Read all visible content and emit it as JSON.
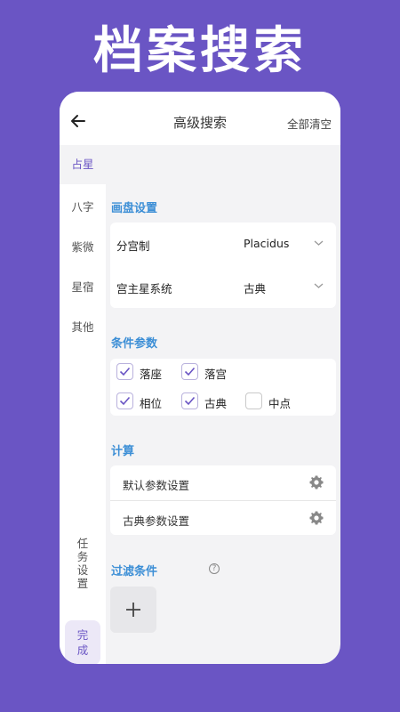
{
  "promo": {
    "title": "档案搜索"
  },
  "header": {
    "title": "高级搜索",
    "clear_all": "全部清空"
  },
  "sidebar": {
    "items": [
      {
        "label": "占星",
        "active": true
      },
      {
        "label": "八字",
        "active": false
      },
      {
        "label": "紫微",
        "active": false
      },
      {
        "label": "星宿",
        "active": false
      },
      {
        "label": "其他",
        "active": false
      }
    ],
    "task_settings": [
      "任",
      "务",
      "设",
      "置"
    ],
    "done": [
      "完",
      "成"
    ]
  },
  "chart_settings": {
    "title": "画盘设置",
    "rows": [
      {
        "label": "分宫制",
        "value": "Placidus"
      },
      {
        "label": "宫主星系统",
        "value": "古典"
      }
    ]
  },
  "conditions": {
    "title": "条件参数",
    "options": [
      {
        "label": "落座",
        "checked": true
      },
      {
        "label": "落宫",
        "checked": true
      },
      {
        "label": "相位",
        "checked": true
      },
      {
        "label": "古典",
        "checked": true
      },
      {
        "label": "中点",
        "checked": false
      }
    ]
  },
  "calculation": {
    "title": "计算",
    "rows": [
      {
        "label": "默认参数设置"
      },
      {
        "label": "古典参数设置"
      }
    ]
  },
  "filters": {
    "title": "过滤条件",
    "help": "?"
  },
  "colors": {
    "accent": "#6a55c4",
    "section_title": "#3d8fd6",
    "background": "#f3f3f5"
  },
  "icons": [
    "back-arrow-icon",
    "chevron-down-icon",
    "check-icon",
    "gear-icon",
    "help-icon",
    "plus-icon"
  ]
}
